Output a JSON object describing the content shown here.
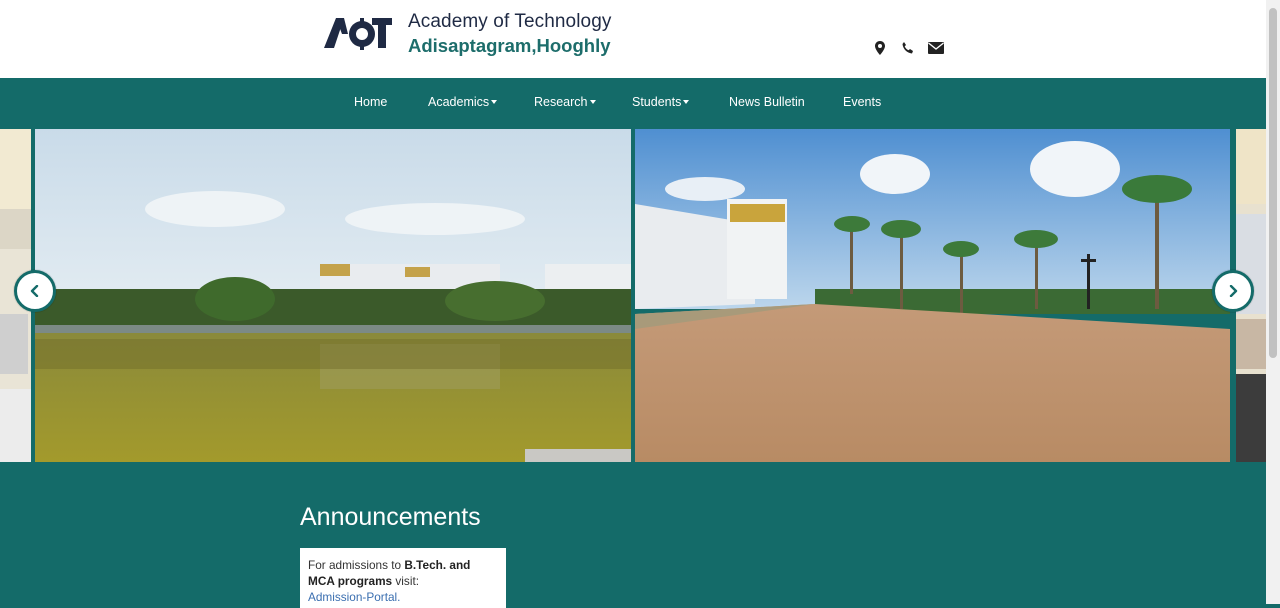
{
  "header": {
    "logo_text": "AOT",
    "title": "Academy of Technology",
    "subtitle": "Adisaptagram,Hooghly",
    "icons": [
      "map-marker-icon",
      "phone-icon",
      "envelope-icon"
    ]
  },
  "nav": {
    "items": [
      {
        "label": "Home",
        "dropdown": false
      },
      {
        "label": "Academics",
        "dropdown": true
      },
      {
        "label": "Research",
        "dropdown": true
      },
      {
        "label": "Students",
        "dropdown": true
      },
      {
        "label": "News Bulletin",
        "dropdown": false
      },
      {
        "label": "Events",
        "dropdown": false
      }
    ]
  },
  "carousel": {
    "prev_icon": "chevron-left-icon",
    "next_icon": "chevron-right-icon",
    "slides": [
      "campus-pond-view",
      "campus-courtyard-view"
    ]
  },
  "announcements": {
    "heading": "Announcements",
    "text_prefix": "For admissions to ",
    "text_bold": "B.Tech. and MCA programs",
    "text_suffix": " visit:",
    "link": "Admission-Portal."
  },
  "colors": {
    "teal": "#146b69",
    "navy": "#1f2a44",
    "link": "#3b6fb0"
  }
}
